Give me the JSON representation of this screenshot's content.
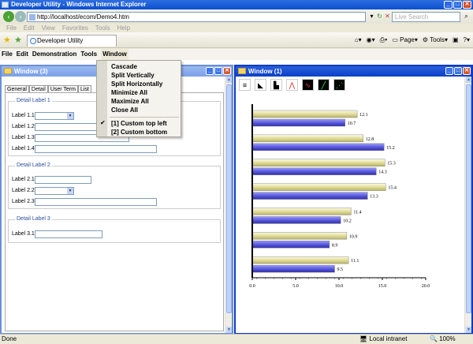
{
  "browser": {
    "title": "Developer Utility - Windows Internet Explorer",
    "address": "http://localhost/ecom/Demo4.htm",
    "search_placeholder": "Live Search",
    "menu": [
      "File",
      "Edit",
      "View",
      "Favorites",
      "Tools",
      "Help"
    ],
    "tab_label": "Developer Utility",
    "toolbar": {
      "page": "Page",
      "tools": "Tools"
    },
    "status": {
      "left": "Done",
      "zone": "Local intranet",
      "zoom": "100%"
    }
  },
  "app_menu": [
    "File",
    "Edit",
    "Demonstration",
    "Tools",
    "Window"
  ],
  "window_menu": {
    "items": [
      "Cascade",
      "Split Vertically",
      "Split Horizontally",
      "Minimize All",
      "Maximize All",
      "Close All"
    ],
    "windows": [
      "[1] Custom top left",
      "[2] Custom bottom"
    ]
  },
  "left_window": {
    "title": "Window (3)",
    "tabs": [
      "General",
      "Detail",
      "User Term",
      "List"
    ],
    "groups": [
      {
        "legend": "Detail Label 1",
        "fields": [
          "Label 1.1:",
          "Label 1.2:",
          "Label 1.3:",
          "Label 1.4:"
        ]
      },
      {
        "legend": "Detail Label 2",
        "fields": [
          "Label 2.1:",
          "Label 2.2:",
          "Label 2.3:"
        ]
      },
      {
        "legend": "Detail Label 3",
        "fields": [
          "Label 3.1:"
        ]
      }
    ]
  },
  "right_window": {
    "title": "Window (1)"
  },
  "chart_data": {
    "type": "bar",
    "orientation": "horizontal",
    "series": [
      {
        "values": [
          12.1,
          12.8,
          15.3,
          15.4,
          11.4,
          10.9,
          11.1
        ],
        "color": "#e6e2a8"
      },
      {
        "values": [
          10.7,
          15.2,
          14.3,
          13.3,
          10.2,
          8.9,
          9.5
        ],
        "color": "#6a6ae0"
      }
    ],
    "xlim": [
      0,
      20
    ],
    "ticks": [
      "0.0",
      "5.0",
      "10.0",
      "15.0",
      "20.0"
    ]
  }
}
